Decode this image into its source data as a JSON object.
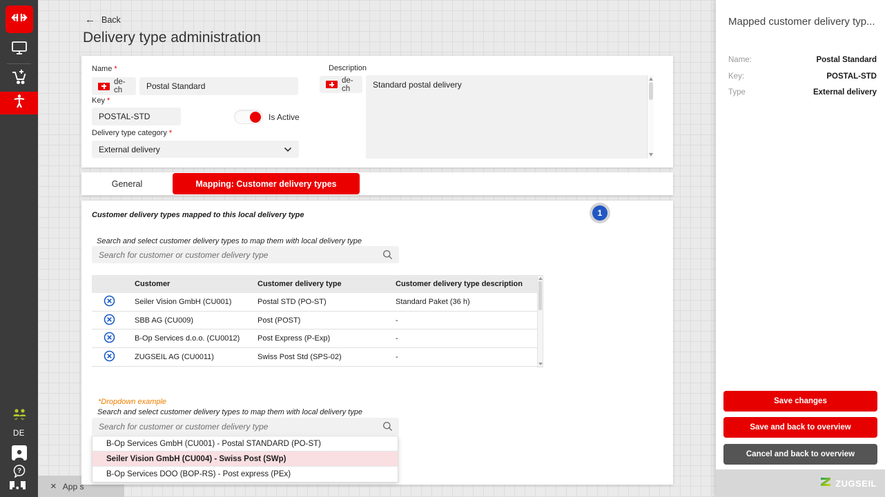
{
  "colors": {
    "accent": "#EB0000",
    "badge_blue": "#2157C2",
    "icon_blue": "#1A5BC5",
    "orange": "#EE7F00",
    "sidebar_green": "#B5C827"
  },
  "sidebar": {
    "locale_label": "DE"
  },
  "header": {
    "back_label": "Back",
    "title": "Delivery type administration"
  },
  "form": {
    "required_mark": "*",
    "name_label": "Name",
    "lang_chip": "de-ch",
    "name_value": "Postal Standard",
    "key_label": "Key",
    "key_value": "POSTAL-STD",
    "is_active_label": "Is Active",
    "category_label": "Delivery type category",
    "category_value": "External delivery",
    "description_label": "Description",
    "description_value": "Standard postal delivery"
  },
  "tabs": {
    "items": [
      {
        "label": "General"
      },
      {
        "label": "Mapping: Customer delivery types"
      }
    ]
  },
  "mapping": {
    "heading": "Customer delivery types mapped to this local delivery type",
    "badge": "1",
    "search_label": "Search and select customer delivery types to map them with local delivery type",
    "search_placeholder": "Search for customer or customer delivery type",
    "table": {
      "columns": [
        "Customer",
        "Customer delivery type",
        "Customer delivery type description"
      ],
      "rows": [
        {
          "customer": "Seiler Vision GmbH (CU001)",
          "type": "Postal STD (PO-ST)",
          "description": "Standard Paket (36 h)"
        },
        {
          "customer": "SBB AG (CU009)",
          "type": "Post (POST)",
          "description": "-"
        },
        {
          "customer": "B-Op Services d.o.o. (CU0012)",
          "type": "Post Express (P-Exp)",
          "description": "-"
        },
        {
          "customer": "ZUGSEIL AG (CU0011)",
          "type": "Swiss Post Std (SPS-02)",
          "description": "-"
        }
      ]
    },
    "dropdown_example": {
      "caption": "*Dropdown example",
      "search_label": "Search and select customer delivery types to map them with local delivery type",
      "search_placeholder": "Search for customer or customer delivery type",
      "options": [
        {
          "label": "B-Op Services GmbH (CU001) - Postal STANDARD (PO-ST)"
        },
        {
          "label": "Seiler Vision GmbH (CU004) - Swiss Post (SWp)"
        },
        {
          "label": "B-Op Services DOO (BOP-RS) - Post express (PEx)"
        }
      ]
    }
  },
  "details_panel": {
    "title": "Mapped customer delivery typ...",
    "fields": [
      {
        "label": "Name:",
        "value": "Postal Standard"
      },
      {
        "label": "Key:",
        "value": "POSTAL-STD"
      },
      {
        "label": "Type",
        "value": "External delivery"
      }
    ],
    "buttons": [
      {
        "label": "Save changes"
      },
      {
        "label": "Save and back to overview"
      },
      {
        "label": "Cancel and back to overview"
      }
    ],
    "brand": "ZUGSEIL"
  },
  "bottom_banner": {
    "label": "App s"
  }
}
